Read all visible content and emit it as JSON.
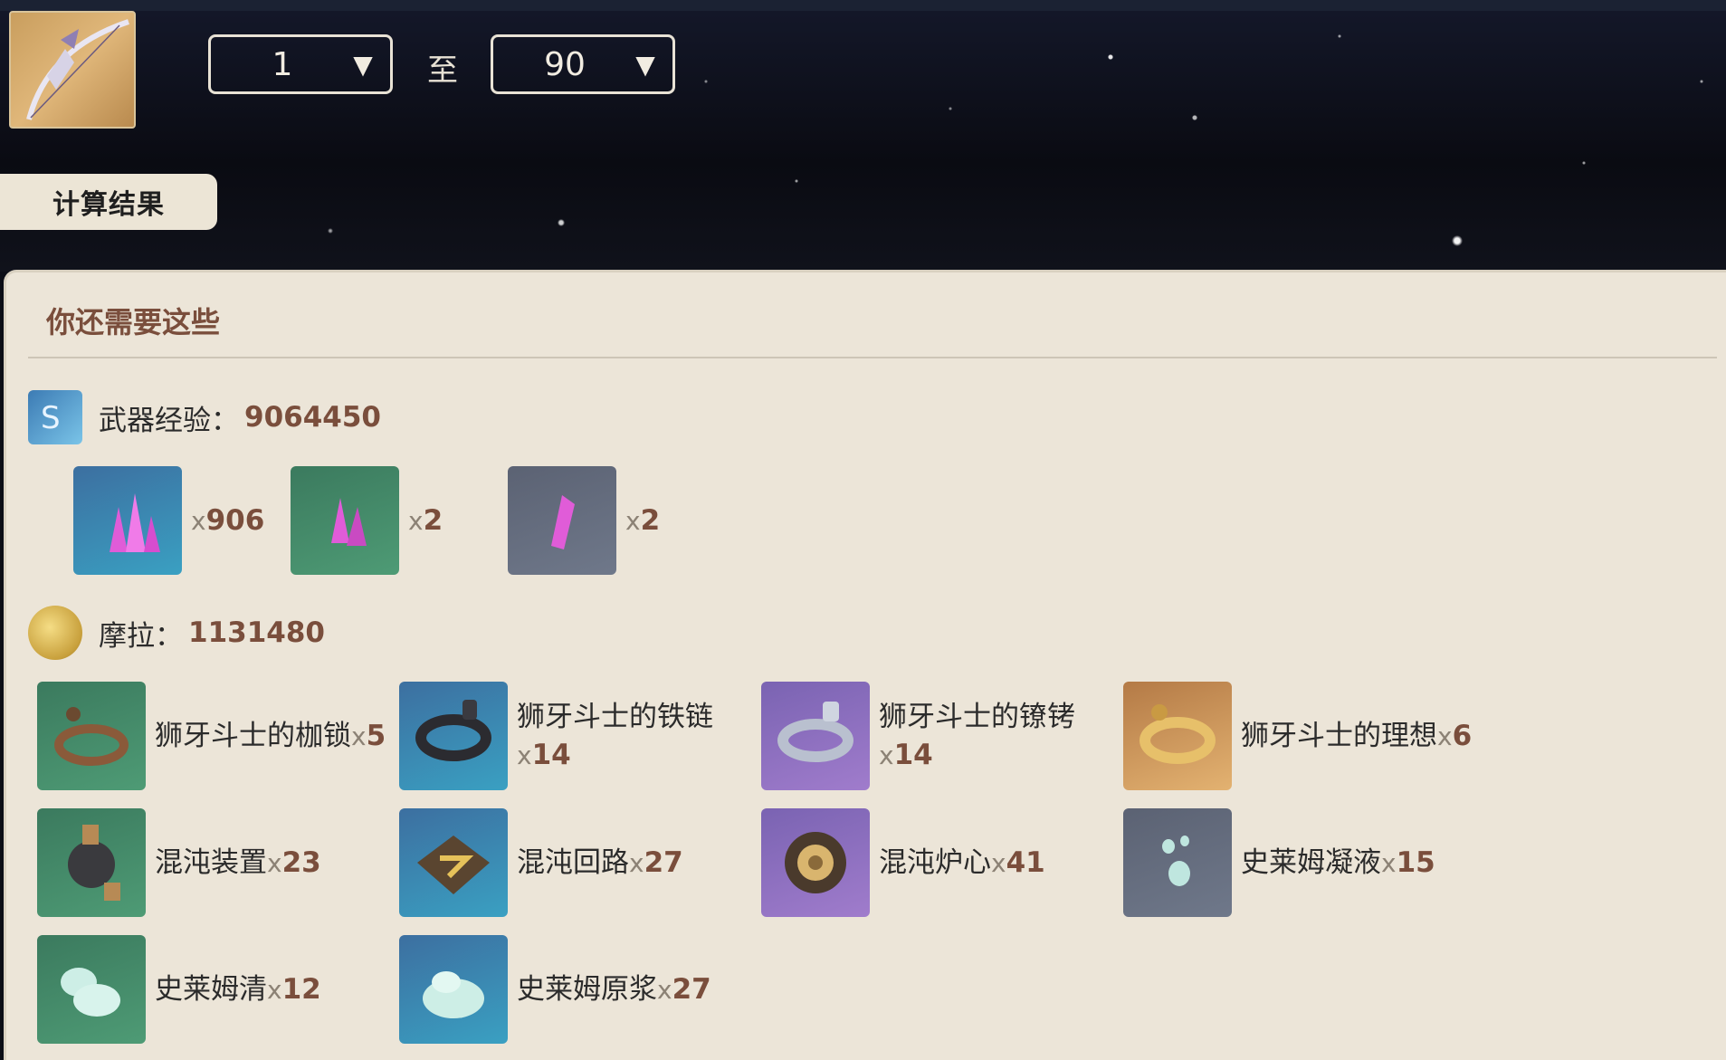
{
  "range": {
    "from": "1",
    "to": "90",
    "to_label": "至",
    "caret": "▼"
  },
  "calc_button": "计算结果",
  "panel": {
    "title": "你还需要这些"
  },
  "weapon_exp": {
    "label": "武器经验：",
    "value": "9064450"
  },
  "ores": [
    {
      "icon": "mystic-enhancement-ore-icon",
      "color": "blue",
      "x": "x",
      "count": "906"
    },
    {
      "icon": "fine-enhancement-ore-icon",
      "color": "green",
      "x": "x",
      "count": "2"
    },
    {
      "icon": "enhancement-ore-icon",
      "color": "gray",
      "x": "x",
      "count": "2"
    }
  ],
  "mora": {
    "label": "摩拉：",
    "value": "1131480"
  },
  "materials": [
    {
      "name": "狮牙斗士的枷锁",
      "x": "x",
      "count": "5",
      "color": "green",
      "icon": "fetters-icon"
    },
    {
      "name": "狮牙斗士的铁链",
      "x": "x",
      "count": "14",
      "color": "blue",
      "icon": "chains-icon"
    },
    {
      "name": "狮牙斗士的镣铐",
      "x": "x",
      "count": "14",
      "color": "purple",
      "icon": "shackles-icon"
    },
    {
      "name": "狮牙斗士的理想",
      "x": "x",
      "count": "6",
      "color": "gold",
      "icon": "ideal-icon"
    },
    {
      "name": "混沌装置",
      "x": "x",
      "count": "23",
      "color": "green",
      "icon": "chaos-device-icon"
    },
    {
      "name": "混沌回路",
      "x": "x",
      "count": "27",
      "color": "blue",
      "icon": "chaos-circuit-icon"
    },
    {
      "name": "混沌炉心",
      "x": "x",
      "count": "41",
      "color": "purple",
      "icon": "chaos-core-icon"
    },
    {
      "name": "史莱姆凝液",
      "x": "x",
      "count": "15",
      "color": "gray",
      "icon": "slime-condensate-icon"
    },
    {
      "name": "史莱姆清",
      "x": "x",
      "count": "12",
      "color": "green",
      "icon": "slime-secretions-icon"
    },
    {
      "name": "史莱姆原浆",
      "x": "x",
      "count": "27",
      "color": "blue",
      "icon": "slime-concentrate-icon"
    }
  ]
}
